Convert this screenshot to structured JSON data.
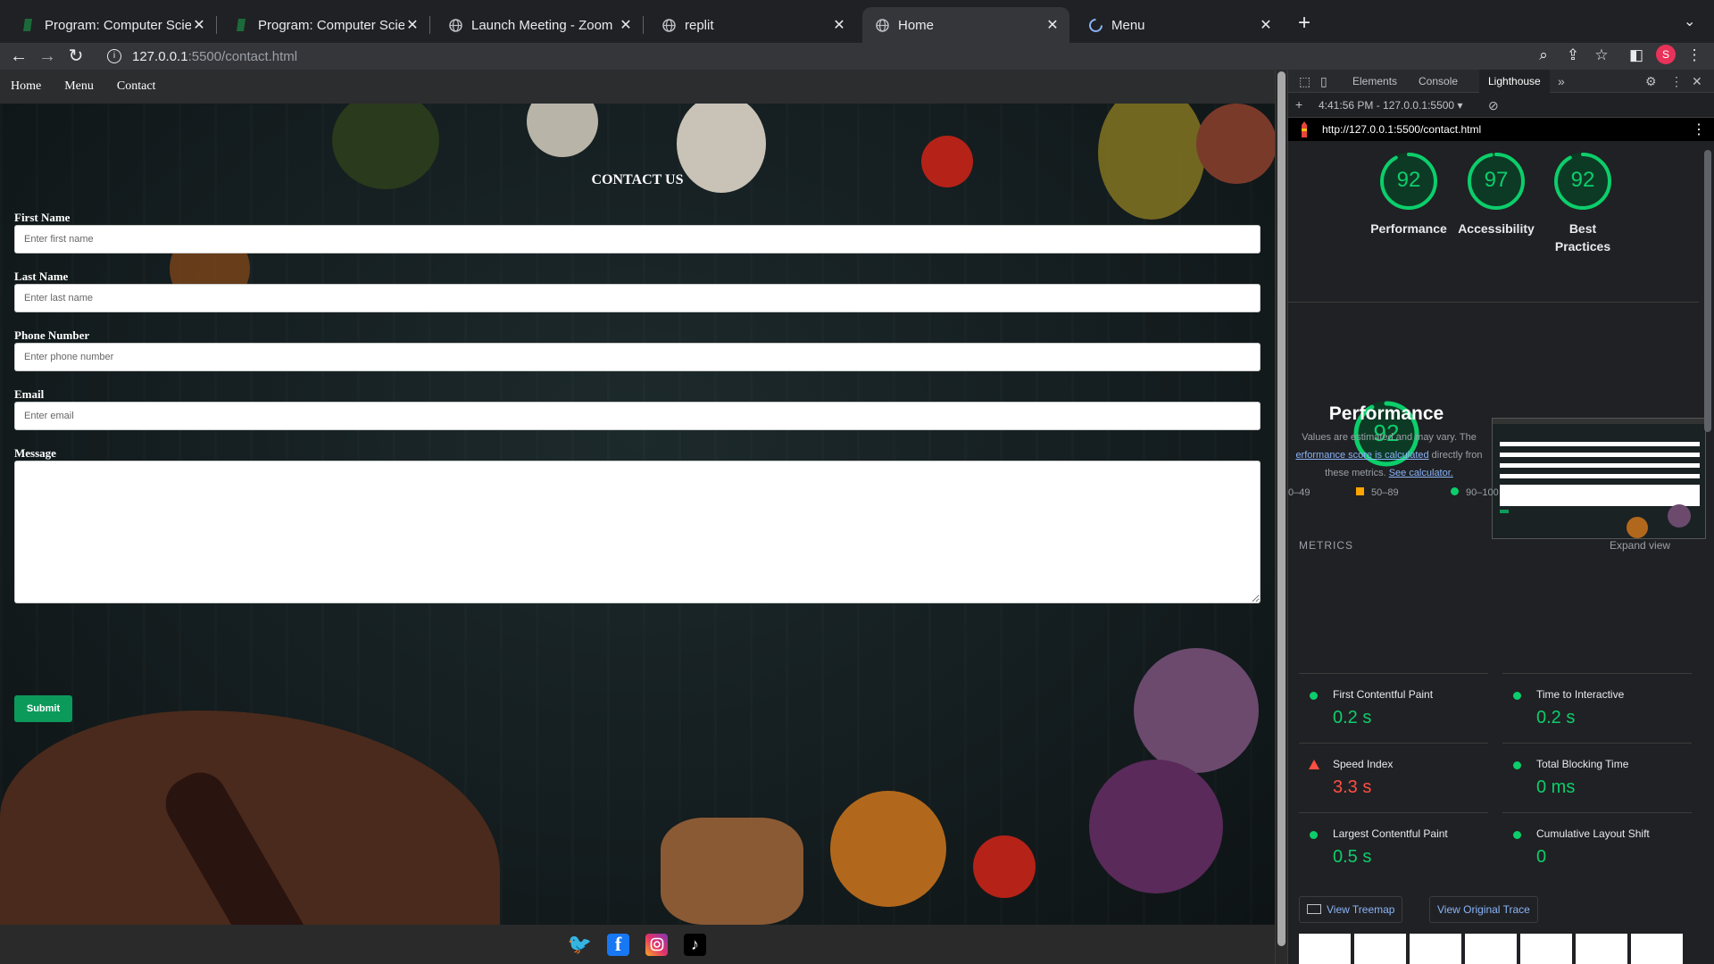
{
  "tabs": [
    {
      "title": "Program: Computer Science, M",
      "favicon": "snhu-icon",
      "active": false
    },
    {
      "title": "Program: Computer Science, M",
      "favicon": "snhu-icon",
      "active": false
    },
    {
      "title": "Launch Meeting - Zoom",
      "favicon": "globe-icon",
      "active": false
    },
    {
      "title": "replit",
      "favicon": "globe-icon",
      "active": false
    },
    {
      "title": "Home",
      "favicon": "globe-icon",
      "active": true
    },
    {
      "title": "Menu",
      "favicon": "loading-icon",
      "active": false
    }
  ],
  "toolbar": {
    "url_host": "127.0.0.1",
    "url_rest": ":5500/contact.html",
    "profile_initial": "S"
  },
  "site": {
    "nav": [
      "Home",
      "Menu",
      "Contact"
    ],
    "title": "CONTACT US",
    "fields": [
      {
        "label": "First Name",
        "placeholder": "Enter first name"
      },
      {
        "label": "Last Name",
        "placeholder": "Enter last name"
      },
      {
        "label": "Phone Number",
        "placeholder": "Enter phone number"
      },
      {
        "label": "Email",
        "placeholder": "Enter email"
      }
    ],
    "message_label": "Message",
    "submit_label": "Submit",
    "social": [
      "twitter-icon",
      "facebook-icon",
      "instagram-icon",
      "tiktok-icon"
    ]
  },
  "devtools": {
    "tabs": [
      "Elements",
      "Console",
      "Lighthouse"
    ],
    "active_tab": "Lighthouse",
    "report_time": "4:41:56 PM - 127.0.0.1:5500",
    "report_url": "http://127.0.0.1:5500/contact.html",
    "scores": [
      {
        "value": 92,
        "label_line1": "Performance",
        "label_line2": ""
      },
      {
        "value": 97,
        "label_line1": "Accessibility",
        "label_line2": ""
      },
      {
        "value": 92,
        "label_line1": "Best",
        "label_line2": "Practices"
      }
    ],
    "perf": {
      "score": 92,
      "title": "Performance",
      "desc1": "Values are estimated and may vary. The",
      "desc_link": "erformance score is calculated",
      "desc2": " directly fron",
      "desc3": "these metrics. ",
      "desc_link2": "See calculator."
    },
    "legend": [
      {
        "range": "0–49",
        "color": "#ff4e42"
      },
      {
        "range": "50–89",
        "color": "#ffa400"
      },
      {
        "range": "90–100",
        "color": "#0cce6b"
      }
    ],
    "metrics_heading": "METRICS",
    "expand_label": "Expand view",
    "metrics": [
      {
        "name": "First Contentful Paint",
        "value": "0.2 s",
        "status": "good"
      },
      {
        "name": "Time to Interactive",
        "value": "0.2 s",
        "status": "good"
      },
      {
        "name": "Speed Index",
        "value": "3.3 s",
        "status": "bad"
      },
      {
        "name": "Total Blocking Time",
        "value": "0 ms",
        "status": "good"
      },
      {
        "name": "Largest Contentful Paint",
        "value": "0.5 s",
        "status": "good"
      },
      {
        "name": "Cumulative Layout Shift",
        "value": "0",
        "status": "good"
      }
    ],
    "treemap_label": "View Treemap",
    "trace_label": "View Original Trace",
    "colors": {
      "good": "#0cce6b",
      "bad": "#ff4e42",
      "average": "#ffa400",
      "link": "#8ab4f8"
    }
  }
}
